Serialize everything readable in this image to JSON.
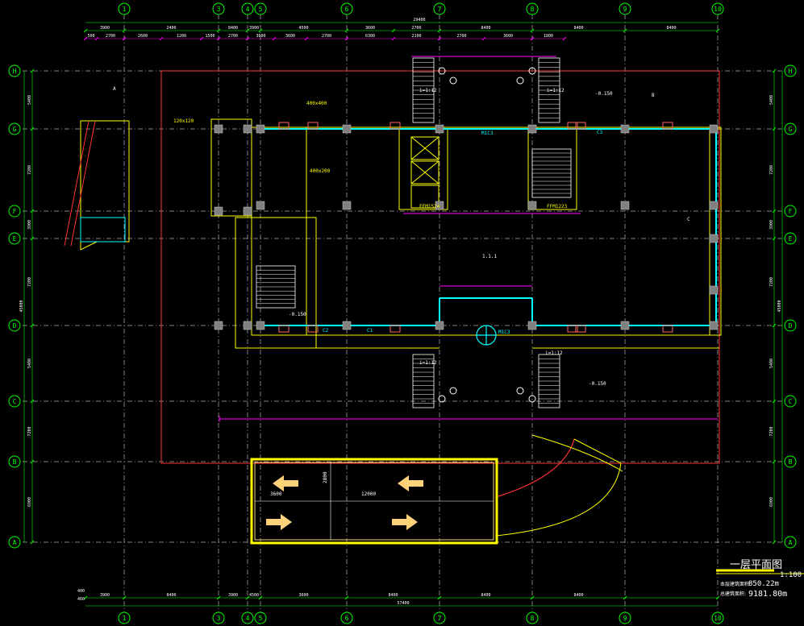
{
  "colors": {
    "background": "#000000",
    "grid": "#ffffff",
    "axis_bubble": "#00ff00",
    "dimension": "#ff00ff",
    "wall": "#ffff00",
    "glass": "#00ffff",
    "column": "#808080",
    "red_line": "#ff3333",
    "note": "#ff3333",
    "arrow": "#ffd27a"
  },
  "grid": {
    "columns_top": [
      "1",
      "3",
      "4",
      "5",
      "6",
      "7",
      "8",
      "9",
      "10"
    ],
    "rows_left": [
      "H",
      "G",
      "F",
      "E",
      "D",
      "C",
      "B",
      "A"
    ],
    "section_marks": [
      "4",
      "2",
      "1",
      "2",
      "4",
      "2",
      "1",
      "4"
    ]
  },
  "dimensions": {
    "top_overall": "29400",
    "top_segments": [
      "3900",
      "2400",
      "8400",
      "3900",
      "4500",
      "3600",
      "2700",
      "8400",
      "8400",
      "8400"
    ],
    "top_small_1": [
      "500",
      "2700",
      "2600",
      "1200",
      "1500",
      "2700",
      "3600",
      "3600",
      "2700",
      "6300",
      "2100",
      "2700",
      "3600",
      "1800"
    ],
    "bottom_overall": "57400",
    "bottom_segments": [
      "3900",
      "8400",
      "3900",
      "4500",
      "3600",
      "8400",
      "8400",
      "8400"
    ],
    "bottom_left": [
      "400",
      "460"
    ],
    "left_total": "45000",
    "right_total": "45000",
    "left_rows": [
      "5400",
      "7200",
      "3900",
      "7200",
      "5400",
      "7200",
      "6900"
    ],
    "right_rows": [
      "5400",
      "7200",
      "3900",
      "7200",
      "5400",
      "7200",
      "6900"
    ]
  },
  "labels": {
    "elev_1": "-0.150",
    "elev_2": "-0.150",
    "elev_3": "-0.150",
    "ramp_1": "i=1:12",
    "ramp_2": "i=1:12",
    "ramp_3": "i=1:12",
    "ramp_4": "i=1:12",
    "door_m1": "M1C3",
    "door_m2": "M1C3",
    "win_c1": "C1",
    "win_c2": "C2",
    "win_c3": "C3",
    "dim_400a": "400x400",
    "dim_400b": "400x200",
    "dim_120": "120x120",
    "dim_3600": "3600",
    "dim_12000": "12000",
    "dim_2800": "2800",
    "fw_1": "FFM1524",
    "fw_2": "FFM1223",
    "note_a": "1.1.1",
    "label_B": "B",
    "label_C": "C",
    "label_A": "A"
  },
  "title_block": {
    "title": "一层平面图",
    "scale": "1:100",
    "area_label_1": "本层建筑面积:",
    "area_value_1": "850.22m",
    "area_label_2": "总建筑面积:",
    "area_value_2": "9181.80m"
  }
}
